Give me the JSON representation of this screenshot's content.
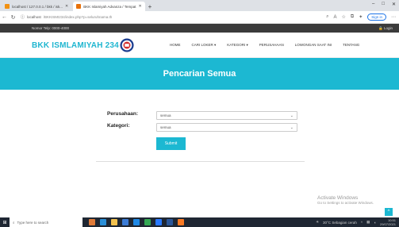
{
  "browser": {
    "tabs": [
      {
        "label": "localhost / 127.0.0.1 / bkk / isk...",
        "favicon_color": "#f29111",
        "active": false
      },
      {
        "label": "BKK Islamiyah Advanza / Tempat",
        "favicon_color": "#e8710a",
        "active": true
      }
    ],
    "new_tab": "+",
    "window_controls": [
      "–",
      "□",
      "✕"
    ],
    "url_host": "localhost",
    "url_path": "/BKKISMI234/index.php?p=seluruhnama.th",
    "signin_label": "Sign in"
  },
  "site": {
    "phone": "Nomor Telp: 0000-4000",
    "login_label": "Login",
    "brand": "BKK ISMLAMIYAH 234",
    "menu": [
      "HOME",
      "CARI LOKER ▾",
      "KATEGORI ▾",
      "PERUSAHAAN",
      "LOWONGAN SAAT INI",
      "TENTANG"
    ],
    "banner_title": "Pencarian Semua"
  },
  "form": {
    "company_label": "Perusahaan:",
    "company_value": "semua",
    "category_label": "Kategori:",
    "category_value": "semua",
    "submit_label": "Submit"
  },
  "watermark": {
    "line1": "Activate Windows",
    "line2": "Go to Settings to activate Windows."
  },
  "taskbar": {
    "search_placeholder": "Type here to search",
    "weather": "30°C Sebagian cerah",
    "time": "10:51",
    "date": "29/07/2021"
  },
  "colors": {
    "accent": "#1cb8d2",
    "topstrip": "#3b3b3b",
    "taskbar": "#1f2733"
  }
}
